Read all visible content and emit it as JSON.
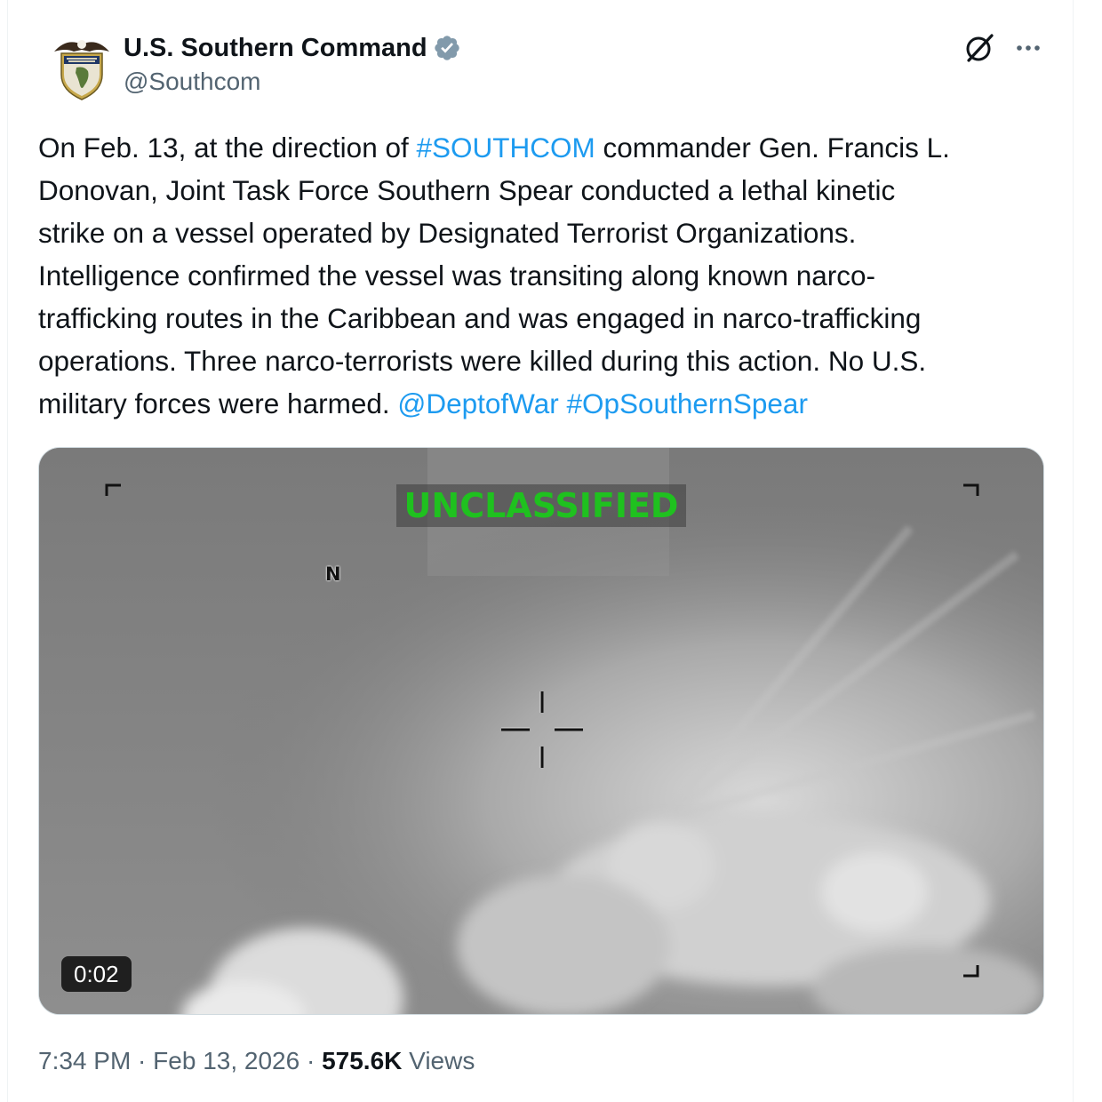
{
  "author": {
    "display_name": "U.S. Southern Command",
    "handle": "@Southcom",
    "verified": true,
    "avatar_icon": "southcom-seal-icon"
  },
  "header_actions": {
    "grok_icon": "grok-icon",
    "more_icon": "more-horizontal-icon",
    "more_glyph": "···"
  },
  "tweet": {
    "lines": [
      [
        {
          "text": "On Feb. 13, at the direction of ",
          "type": "text"
        },
        {
          "text": "#SOUTHCOM",
          "type": "hashtag"
        },
        {
          "text": " commander Gen. Francis L.",
          "type": "text"
        }
      ],
      [
        {
          "text": "Donovan, Joint Task Force Southern Spear conducted a lethal kinetic",
          "type": "text"
        }
      ],
      [
        {
          "text": "strike on a vessel operated by Designated Terrorist Organizations.",
          "type": "text"
        }
      ],
      [
        {
          "text": "Intelligence confirmed the vessel was transiting along known narco-",
          "type": "text"
        }
      ],
      [
        {
          "text": "trafficking routes in the Caribbean and was engaged in narco-trafficking",
          "type": "text"
        }
      ],
      [
        {
          "text": "operations. Three narco-terrorists were killed during this action. No U.S.",
          "type": "text"
        }
      ],
      [
        {
          "text": "military forces were harmed. ",
          "type": "text"
        },
        {
          "text": "@DeptofWar",
          "type": "mention"
        },
        {
          "text": " ",
          "type": "text"
        },
        {
          "text": "#OpSouthernSpear",
          "type": "hashtag"
        }
      ]
    ]
  },
  "media": {
    "type": "video",
    "overlay_classification": "UNCLASSIFIED",
    "overlay_north": "N",
    "duration": "0:02",
    "colors": {
      "classification_text": "#1fc11f",
      "sky": "#7c7c7c"
    }
  },
  "footer": {
    "time": "7:34 PM",
    "separator": " · ",
    "date": "Feb 13, 2026",
    "views_count": "575.6K",
    "views_label": " Views"
  },
  "colors": {
    "link": "#1d9bf0",
    "text_primary": "#0f1419",
    "text_secondary": "#536471",
    "verified_badge": "#829aab"
  }
}
